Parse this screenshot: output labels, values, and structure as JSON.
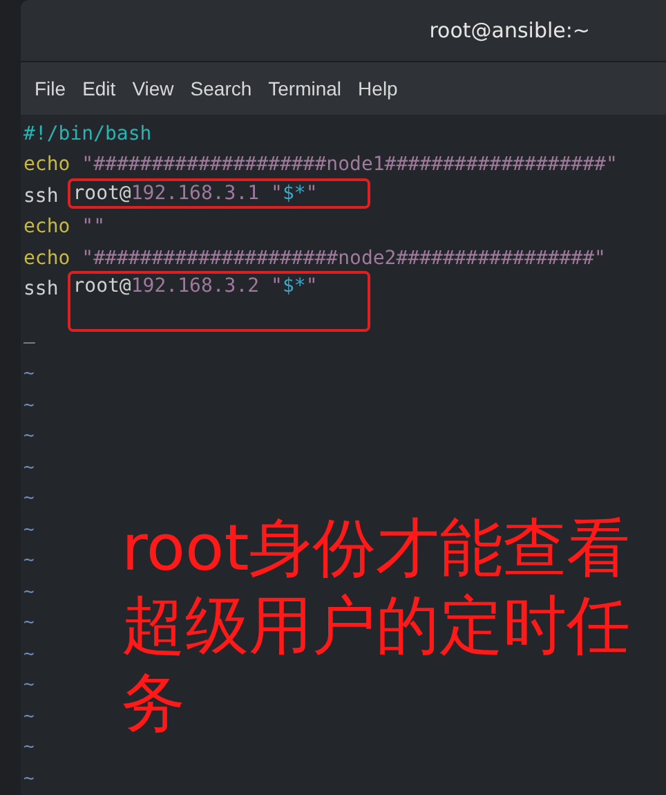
{
  "window": {
    "title": "root@ansible:~"
  },
  "menu": [
    "File",
    "Edit",
    "View",
    "Search",
    "Terminal",
    "Help"
  ],
  "lines": [
    {
      "segments": [
        {
          "kind": "shebang",
          "text": "#!/bin/bash"
        }
      ]
    },
    {
      "segments": [
        {
          "kind": "keyword",
          "text": "echo "
        },
        {
          "kind": "string",
          "text": "\"####################node1###################\""
        }
      ]
    },
    {
      "segments": [
        {
          "kind": "plain",
          "text": "ssh "
        }
      ],
      "highlight": {
        "tall": false,
        "segments": [
          {
            "kind": "plain",
            "text": "root@"
          },
          {
            "kind": "string",
            "text": "192.168.3.1 \""
          },
          {
            "kind": "special",
            "text": "$*"
          },
          {
            "kind": "string",
            "text": "\""
          }
        ]
      }
    },
    {
      "segments": [
        {
          "kind": "keyword",
          "text": "echo "
        },
        {
          "kind": "string",
          "text": "\"\""
        }
      ]
    },
    {
      "segments": [
        {
          "kind": "keyword",
          "text": "echo "
        },
        {
          "kind": "string",
          "text": "\"#####################node2#################\""
        }
      ]
    },
    {
      "segments": [
        {
          "kind": "plain",
          "text": "ssh "
        }
      ],
      "highlight": {
        "tall": true,
        "segments": [
          {
            "kind": "plain",
            "text": "root@"
          },
          {
            "kind": "string",
            "text": "192.168.3.2 \""
          },
          {
            "kind": "special",
            "text": "$*"
          },
          {
            "kind": "string",
            "text": "\""
          }
        ]
      }
    }
  ],
  "cursor": "_",
  "tildes": [
    "~",
    "~",
    "~",
    "~",
    "~",
    "~",
    "~",
    "~",
    "~",
    "~",
    "~",
    "~",
    "~",
    "~"
  ],
  "note": "root身份才能查看超级用户的定时任务"
}
